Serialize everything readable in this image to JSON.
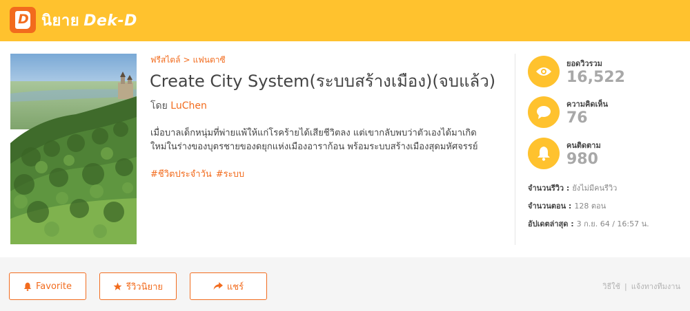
{
  "header": {
    "logo_thai": "นิยาย",
    "logo_brand": "Dek-D",
    "logo_letter": "D"
  },
  "novel": {
    "breadcrumb": [
      "ฟรีสไตล์",
      "แฟนตาซี"
    ],
    "breadcrumb_sep": ">",
    "title": "Create City System(ระบบสร้างเมือง)(จบแล้ว)",
    "author_prefix": "โดย",
    "author_name": "LuChen",
    "description_line1": "เมื่อบาลเด็กหนุ่มที่พ่ายแพ้ให้แก่โรคร้ายได้เสียชีวิตลง แต่เขากลับพบว่าตัวเองได้มาเกิด",
    "description_line2": "ใหม่ในร่างของบุตรชายของดยุกแห่งเมืองอาราก้อน พร้อมระบบสร้างเมืองสุดมหัศจรรย์",
    "tags": [
      "#ชีวิตประจำวัน",
      "#ระบบ"
    ]
  },
  "stats": {
    "views_label": "ยอดวิวรวม",
    "views_value": "16,522",
    "comments_label": "ความคิดเห็น",
    "comments_value": "76",
    "followers_label": "คนติดตาม",
    "followers_value": "980"
  },
  "meta": {
    "reviews_label": "จำนวนรีวิว :",
    "reviews_value": "ยังไม่มีคนรีวิว",
    "chapters_label": "จำนวนตอน :",
    "chapters_value": "128 ตอน",
    "updated_label": "อัปเดตล่าสุด :",
    "updated_value": "3 ก.ย. 64 / 16:57 น."
  },
  "actions": {
    "favorite": "Favorite",
    "review": "รีวิวนิยาย",
    "share": "แชร์"
  },
  "footer_links": {
    "guide": "วิธีใช้",
    "sep": "|",
    "report": "แจ้งทางทีมงาน"
  },
  "colors": {
    "header_bg": "#ffc22e",
    "accent": "#f26b1d",
    "stat_value": "#a8a8a8"
  },
  "icons": {
    "logo": "dek-d-book-icon",
    "views": "eye-icon",
    "comments": "speech-bubble-icon",
    "followers": "bell-icon",
    "favorite": "bell-icon",
    "review": "star-icon",
    "share": "share-arrow-icon"
  }
}
